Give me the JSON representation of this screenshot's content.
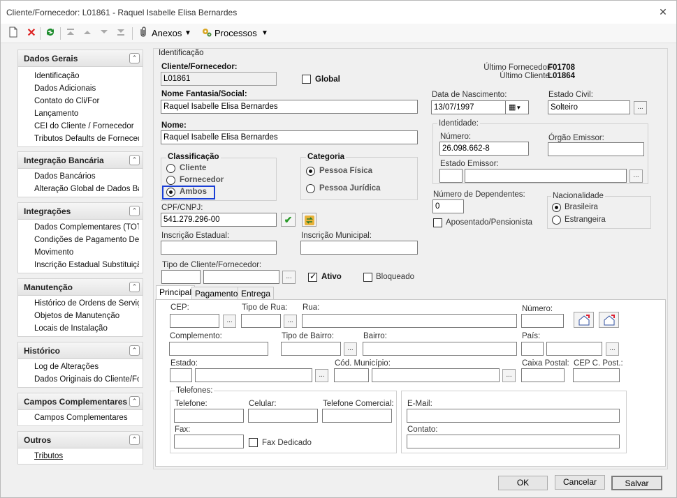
{
  "window": {
    "title": "Cliente/Fornecedor: L01861 - Raquel Isabelle Elisa Bernardes"
  },
  "toolbar": {
    "anexos": "Anexos",
    "processos": "Processos"
  },
  "sidebar": [
    {
      "title": "Dados Gerais",
      "items": [
        "Identificação",
        "Dados Adicionais",
        "Contato do Cli/For",
        "Lançamento",
        "CEI do Cliente  /  Fornecedor",
        "Tributos Defaults de Fornecedor"
      ]
    },
    {
      "title": "Integração Bancária",
      "items": [
        "Dados Bancários",
        "Alteração Global de Dados Bancários"
      ]
    },
    {
      "title": "Integrações",
      "items": [
        "Dados Complementares (TOTVS)",
        "Condições de Pagamento Default",
        "Movimento",
        "Inscrição Estadual Substituição"
      ]
    },
    {
      "title": "Manutenção",
      "items": [
        "Histórico de Ordens de Serviço",
        "Objetos de Manutenção",
        "Locais de Instalação"
      ]
    },
    {
      "title": "Histórico",
      "items": [
        "Log de Alterações",
        "Dados Originais do Cliente/Fornecedor"
      ]
    },
    {
      "title": "Campos Complementares",
      "items": [
        "Campos Complementares"
      ]
    },
    {
      "title": "Outros",
      "items": [
        "Tributos"
      ]
    }
  ],
  "form": {
    "section_title": "Identificação",
    "cliente_label": "Cliente/Fornecedor:",
    "cliente_value": "L01861",
    "global_label": "Global",
    "ultimo_fornecedor_label": "Último Fornecedor:",
    "ultimo_fornecedor_value": "F01708",
    "ultimo_cliente_label": "Último Cliente:",
    "ultimo_cliente_value": "L01864",
    "nome_fantasia_label": "Nome Fantasia/Social:",
    "nome_fantasia_value": "Raquel Isabelle Elisa Bernardes",
    "nome_label": "Nome:",
    "nome_value": "Raquel Isabelle Elisa Bernardes",
    "data_nasc_label": "Data de Nascimento:",
    "data_nasc_value": "13/07/1997",
    "estado_civil_label": "Estado Civil:",
    "estado_civil_value": "Solteiro",
    "identidade_title": "Identidade:",
    "numero_label": "Número:",
    "numero_value": "26.098.662-8",
    "orgao_label": "Órgão Emissor:",
    "estado_emissor_label": "Estado Emissor:",
    "classificacao_title": "Classificação",
    "classificacao_options": [
      "Cliente",
      "Fornecedor",
      "Ambos"
    ],
    "categoria_title": "Categoria",
    "categoria_options": [
      "Pessoa Física",
      "Pessoa Jurídica"
    ],
    "dependentes_label": "Número de Dependentes:",
    "dependentes_value": "0",
    "aposentado_label": "Aposentado/Pensionista",
    "nacionalidade_title": "Nacionalidade",
    "nacionalidade_options": [
      "Brasileira",
      "Estrangeira"
    ],
    "cpf_label": "CPF/CNPJ:",
    "cpf_value": "541.279.296-00",
    "insc_estadual_label": "Inscrição Estadual:",
    "insc_municipal_label": "Inscrição Municipal:",
    "tipo_cliente_label": "Tipo de Cliente/Fornecedor:",
    "ativo_label": "Ativo",
    "bloqueado_label": "Bloqueado"
  },
  "tabs": [
    "Principal",
    "Pagamento",
    "Entrega"
  ],
  "address": {
    "cep": "CEP:",
    "tipo_rua": "Tipo de Rua:",
    "rua": "Rua:",
    "numero": "Número:",
    "complemento": "Complemento:",
    "tipo_bairro": "Tipo de Bairro:",
    "bairro": "Bairro:",
    "pais": "País:",
    "estado": "Estado:",
    "cod_municipio": "Cód. Município:",
    "caixa_postal": "Caixa Postal:",
    "cep_cpost": "CEP C. Post.:",
    "telefones_title": "Telefones:",
    "telefone": "Telefone:",
    "celular": "Celular:",
    "telefone_comercial": "Telefone Comercial:",
    "fax": "Fax:",
    "fax_dedicado": "Fax Dedicado",
    "email": "E-Mail:",
    "contato": "Contato:"
  },
  "buttons": {
    "ok": "OK",
    "cancelar": "Cancelar",
    "salvar": "Salvar"
  }
}
